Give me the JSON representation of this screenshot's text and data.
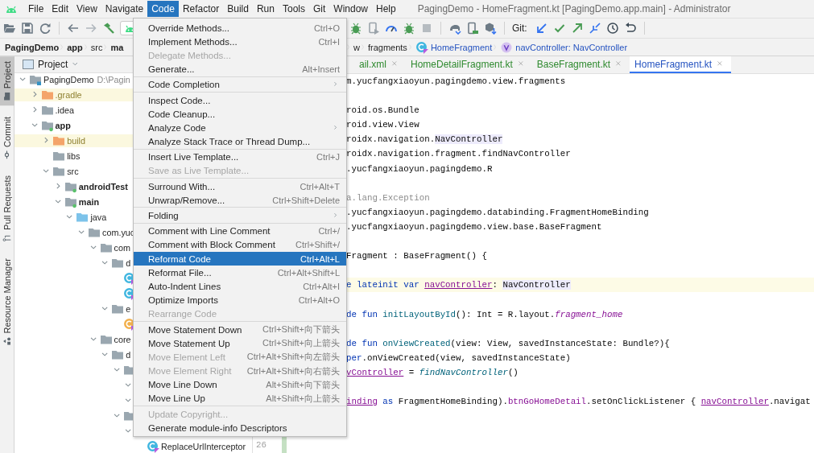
{
  "menubar": {
    "items": [
      {
        "label": "File",
        "selected": false
      },
      {
        "label": "Edit",
        "selected": false
      },
      {
        "label": "View",
        "selected": false
      },
      {
        "label": "Navigate",
        "selected": false
      },
      {
        "label": "Code",
        "selected": true
      },
      {
        "label": "Refactor",
        "selected": false
      },
      {
        "label": "Build",
        "selected": false
      },
      {
        "label": "Run",
        "selected": false
      },
      {
        "label": "Tools",
        "selected": false
      },
      {
        "label": "Git",
        "selected": false
      },
      {
        "label": "Window",
        "selected": false
      },
      {
        "label": "Help",
        "selected": false
      }
    ],
    "title": "PagingDemo - HomeFragment.kt [PagingDemo.app.main] - Administrator"
  },
  "toolbar": {
    "git_label": "Git:"
  },
  "breadcrumbs": {
    "left": [
      {
        "label": "PagingDemo",
        "kind": "module"
      },
      {
        "label": "app",
        "kind": "module"
      },
      {
        "label": "src",
        "kind": "folder"
      },
      {
        "label": "ma",
        "kind": "module"
      }
    ],
    "right": [
      {
        "label": "w",
        "kind": "folder"
      },
      {
        "label": "fragments",
        "kind": "folder"
      },
      {
        "label": "HomeFragment",
        "kind": "class"
      },
      {
        "label": "navController: NavController",
        "kind": "property"
      }
    ]
  },
  "tool_strip": {
    "tabs": [
      {
        "label": "Project",
        "kind": "project",
        "selected": true
      },
      {
        "label": "Commit",
        "kind": "commit",
        "selected": false
      },
      {
        "label": "Pull Requests",
        "kind": "pull-requests",
        "selected": false
      },
      {
        "label": "Resource Manager",
        "kind": "resources",
        "selected": false
      }
    ]
  },
  "project_panel": {
    "title": "Project",
    "tree": [
      {
        "label": "PagingDemo",
        "path": "D:\\Pagin",
        "kind": "project",
        "expanded": true,
        "children": [
          {
            "label": ".gradle",
            "kind": "excluded",
            "expanded": false
          },
          {
            "label": ".idea",
            "kind": "folder",
            "expanded": false
          },
          {
            "label": "app",
            "kind": "module",
            "expanded": true,
            "children": [
              {
                "label": "build",
                "kind": "excluded",
                "expanded": false
              },
              {
                "label": "libs",
                "kind": "folder"
              },
              {
                "label": "src",
                "kind": "folder",
                "expanded": true,
                "children": [
                  {
                    "label": "androidTest",
                    "kind": "module",
                    "expanded": false
                  },
                  {
                    "label": "main",
                    "kind": "module",
                    "expanded": true,
                    "children": [
                      {
                        "label": "java",
                        "kind": "source",
                        "expanded": true,
                        "children": [
                          {
                            "label": "com.yuc",
                            "kind": "folder",
                            "expanded": true,
                            "children": [
                              {
                                "label": "com",
                                "kind": "folder",
                                "expanded": true,
                                "children": [
                                  {
                                    "label": "d",
                                    "kind": "folder",
                                    "expanded": true,
                                    "children": [
                                      {
                                        "kind": "class"
                                      },
                                      {
                                        "kind": "class"
                                      }
                                    ]
                                  },
                                  {
                                    "label": "e",
                                    "kind": "folder",
                                    "expanded": true,
                                    "children": [
                                      {
                                        "kind": "exception"
                                      }
                                    ]
                                  }
                                ]
                              },
                              {
                                "label": "core",
                                "kind": "folder",
                                "expanded": true,
                                "children": [
                                  {
                                    "label": "d",
                                    "kind": "folder",
                                    "expanded": true,
                                    "children": [
                                      {
                                        "kind": "folder",
                                        "expanded": true,
                                        "children": [
                                          {
                                            "expanded": true
                                          },
                                          {
                                            "expanded": true
                                          }
                                        ]
                                      },
                                      {
                                        "kind": "folder",
                                        "expanded": true,
                                        "children": [
                                          {
                                            "expanded": true,
                                            "children": [
                                              {
                                                "label": "ReplaceUrlInterceptor",
                                                "kind": "class"
                                              }
                                            ]
                                          }
                                        ]
                                      }
                                    ]
                                  }
                                ]
                              }
                            ]
                          }
                        ]
                      }
                    ]
                  }
                ]
              }
            ]
          }
        ]
      }
    ]
  },
  "editor": {
    "tabs": [
      {
        "label": "ail.xml",
        "color": "#2f8a2f",
        "selected": false
      },
      {
        "label": "HomeDetailFragment.kt",
        "color": "#2f8a2f",
        "selected": false
      },
      {
        "label": "BaseFragment.kt",
        "color": "#2f8a2f",
        "selected": false
      },
      {
        "label": "HomeFragment.kt",
        "color": "#2553c0",
        "selected": true
      }
    ],
    "line_number": "26",
    "lines": [
      {
        "current": false,
        "tokens": [
          {
            "text": "m.yucfangxiaoyun.pagingdemo.view.fragments",
            "kind": "plain"
          }
        ]
      },
      {
        "current": false
      },
      {
        "current": false,
        "tokens": [
          {
            "text": "roid.os.Bundle",
            "kind": "plain"
          }
        ]
      },
      {
        "current": false,
        "tokens": [
          {
            "text": "roid.view.View",
            "kind": "plain"
          }
        ]
      },
      {
        "current": false,
        "tokens": [
          {
            "text": "roidx.navigation.",
            "kind": "plain"
          },
          {
            "text": "NavController",
            "kind": "usage"
          }
        ]
      },
      {
        "current": false,
        "tokens": [
          {
            "text": "roidx.navigation.fragment.findNavController",
            "kind": "plain"
          }
        ]
      },
      {
        "current": false,
        "tokens": [
          {
            "text": ".yucfangxiaoyun.pagingdemo.R",
            "kind": "plain"
          }
        ]
      },
      {
        "current": false
      },
      {
        "current": false,
        "tokens": [
          {
            "text": "a.lang.Exception",
            "kind": "unused"
          }
        ]
      },
      {
        "current": false,
        "tokens": [
          {
            "text": ".yucfangxiaoyun.pagingdemo.databinding.FragmentHomeBinding",
            "kind": "plain"
          }
        ]
      },
      {
        "current": false,
        "tokens": [
          {
            "text": ".yucfangxiaoyun.pagingdemo.view.base.BaseFragment",
            "kind": "plain"
          }
        ]
      },
      {
        "current": false
      },
      {
        "current": false,
        "tokens": [
          {
            "text": "Fragment : BaseFragment() {",
            "kind": "plain"
          }
        ]
      },
      {
        "current": false
      },
      {
        "current": true,
        "tokens": [
          {
            "text": "e lateinit var ",
            "kind": "keyword"
          },
          {
            "text": "navController",
            "kind": "variable"
          },
          {
            "text": ": ",
            "kind": "plain"
          },
          {
            "text": "NavController",
            "kind": "usage"
          }
        ]
      },
      {
        "current": false
      },
      {
        "current": false,
        "tokens": [
          {
            "text": "de fun ",
            "kind": "keyword"
          },
          {
            "text": "initLayoutById",
            "kind": "function"
          },
          {
            "text": "(): Int = R.layout.",
            "kind": "plain"
          },
          {
            "text": "fragment_home",
            "kind": "static-property"
          }
        ]
      },
      {
        "current": false
      },
      {
        "current": false,
        "tokens": [
          {
            "text": "de fun ",
            "kind": "keyword"
          },
          {
            "text": "onViewCreated",
            "kind": "function"
          },
          {
            "text": "(view: View, savedInstanceState: Bundle?){",
            "kind": "plain"
          }
        ]
      },
      {
        "current": false,
        "tokens": [
          {
            "text": "per",
            "kind": "keyword"
          },
          {
            "text": ".onViewCreated(view, savedInstanceState)",
            "kind": "plain"
          }
        ]
      },
      {
        "current": false,
        "tokens": [
          {
            "text": "vController",
            "kind": "variable"
          },
          {
            "text": " = ",
            "kind": "plain"
          },
          {
            "text": "findNavController",
            "kind": "extension-call"
          },
          {
            "text": "()",
            "kind": "plain"
          }
        ]
      },
      {
        "current": false
      },
      {
        "current": false,
        "tokens": [
          {
            "text": "inding",
            "kind": "variable"
          },
          {
            "text": " as",
            "kind": "keyword"
          },
          {
            "text": " FragmentHomeBinding).",
            "kind": "plain"
          },
          {
            "text": "btnGoHomeDetail",
            "kind": "property"
          },
          {
            "text": ".setOnClickListener { ",
            "kind": "plain"
          },
          {
            "text": "navController",
            "kind": "variable"
          },
          {
            "text": ".navigat",
            "kind": "plain"
          }
        ]
      },
      {
        "current": false
      },
      {
        "current": false
      },
      {
        "current": false
      }
    ]
  },
  "code_menu": {
    "groups": [
      {
        "items": [
          {
            "label": "Override Methods...",
            "shortcut": "Ctrl+O",
            "disabled": false,
            "selected": false,
            "submenu": false
          },
          {
            "label": "Implement Methods...",
            "shortcut": "Ctrl+I",
            "disabled": false,
            "selected": false,
            "submenu": false
          },
          {
            "label": "Delegate Methods...",
            "disabled": true,
            "selected": false,
            "submenu": false
          },
          {
            "label": "Generate...",
            "shortcut": "Alt+Insert",
            "disabled": false,
            "selected": false,
            "submenu": false
          }
        ]
      },
      {
        "items": [
          {
            "label": "Code Completion",
            "disabled": false,
            "selected": false,
            "submenu": true
          }
        ]
      },
      {
        "items": [
          {
            "label": "Inspect Code...",
            "disabled": false,
            "selected": false,
            "submenu": false
          },
          {
            "label": "Code Cleanup...",
            "disabled": false,
            "selected": false,
            "submenu": false
          },
          {
            "label": "Analyze Code",
            "disabled": false,
            "selected": false,
            "submenu": true
          },
          {
            "label": "Analyze Stack Trace or Thread Dump...",
            "disabled": false,
            "selected": false,
            "submenu": false
          }
        ]
      },
      {
        "items": [
          {
            "label": "Insert Live Template...",
            "shortcut": "Ctrl+J",
            "disabled": false,
            "selected": false,
            "submenu": false
          },
          {
            "label": "Save as Live Template...",
            "disabled": true,
            "selected": false,
            "submenu": false
          }
        ]
      },
      {
        "items": [
          {
            "label": "Surround With...",
            "shortcut": "Ctrl+Alt+T",
            "disabled": false,
            "selected": false,
            "submenu": false
          },
          {
            "label": "Unwrap/Remove...",
            "shortcut": "Ctrl+Shift+Delete",
            "disabled": false,
            "selected": false,
            "submenu": false
          }
        ]
      },
      {
        "items": [
          {
            "label": "Folding",
            "disabled": false,
            "selected": false,
            "submenu": true
          }
        ]
      },
      {
        "items": [
          {
            "label": "Comment with Line Comment",
            "shortcut": "Ctrl+/",
            "disabled": false,
            "selected": false,
            "submenu": false
          },
          {
            "label": "Comment with Block Comment",
            "shortcut": "Ctrl+Shift+/",
            "disabled": false,
            "selected": false,
            "submenu": false
          },
          {
            "label": "Reformat Code",
            "shortcut": "Ctrl+Alt+L",
            "disabled": false,
            "selected": true,
            "submenu": false
          },
          {
            "label": "Reformat File...",
            "shortcut": "Ctrl+Alt+Shift+L",
            "disabled": false,
            "selected": false,
            "submenu": false
          },
          {
            "label": "Auto-Indent Lines",
            "shortcut": "Ctrl+Alt+I",
            "disabled": false,
            "selected": false,
            "submenu": false
          },
          {
            "label": "Optimize Imports",
            "shortcut": "Ctrl+Alt+O",
            "disabled": false,
            "selected": false,
            "submenu": false
          },
          {
            "label": "Rearrange Code",
            "disabled": true,
            "selected": false,
            "submenu": false
          }
        ]
      },
      {
        "items": [
          {
            "label": "Move Statement Down",
            "shortcut": "Ctrl+Shift+向下箭头",
            "disabled": false,
            "selected": false,
            "submenu": false
          },
          {
            "label": "Move Statement Up",
            "shortcut": "Ctrl+Shift+向上箭头",
            "disabled": false,
            "selected": false,
            "submenu": false
          },
          {
            "label": "Move Element Left",
            "shortcut": "Ctrl+Alt+Shift+向左箭头",
            "disabled": true,
            "selected": false,
            "submenu": false
          },
          {
            "label": "Move Element Right",
            "shortcut": "Ctrl+Alt+Shift+向右箭头",
            "disabled": true,
            "selected": false,
            "submenu": false
          },
          {
            "label": "Move Line Down",
            "shortcut": "Alt+Shift+向下箭头",
            "disabled": false,
            "selected": false,
            "submenu": false
          },
          {
            "label": "Move Line Up",
            "shortcut": "Alt+Shift+向上箭头",
            "disabled": false,
            "selected": false,
            "submenu": false
          }
        ]
      },
      {
        "items": [
          {
            "label": "Update Copyright...",
            "disabled": true,
            "selected": false,
            "submenu": false
          },
          {
            "label": "Generate module-info Descriptors",
            "disabled": false,
            "selected": false,
            "submenu": false
          }
        ]
      }
    ]
  }
}
